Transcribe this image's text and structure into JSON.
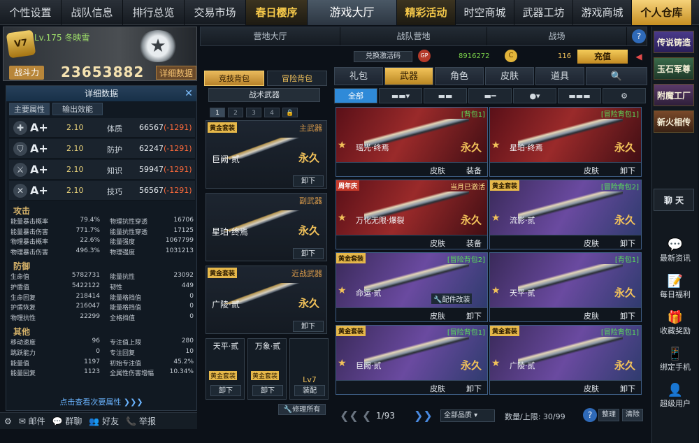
{
  "topnav": {
    "tabs": [
      "个性设置",
      "战队信息",
      "排行总览",
      "交易市场",
      "春日樱序",
      "游戏大厅",
      "精彩活动",
      "时空商城",
      "武器工坊",
      "游戏商城",
      "个人仓库"
    ]
  },
  "profile": {
    "level_name": "Lv.175 冬映雪",
    "level_badge": "V7",
    "cp_label": "战斗力",
    "cp_value": "23653882",
    "detail_btn": "详细数据"
  },
  "attr": {
    "title": "详细数据",
    "close": "✕",
    "subtabs": [
      "主要属性",
      "输出效能"
    ],
    "rows": [
      {
        "icon": "✚",
        "grade": "A+",
        "mul": "2.10",
        "name": "体质",
        "val": "66567",
        "diff": "(-1291)"
      },
      {
        "icon": "⛉",
        "grade": "A+",
        "mul": "2.10",
        "name": "防护",
        "val": "62247",
        "diff": "(-1291)"
      },
      {
        "icon": "⚔",
        "grade": "A+",
        "mul": "2.10",
        "name": "知识",
        "val": "59947",
        "diff": "(-1291)"
      },
      {
        "icon": "✕",
        "grade": "A+",
        "mul": "2.10",
        "name": "技巧",
        "val": "56567",
        "diff": "(-1291)"
      }
    ],
    "sections": [
      {
        "title": "攻击",
        "stats": [
          [
            "能量暴击概率",
            "79.4%",
            "物理抗性穿透",
            "16706"
          ],
          [
            "能量暴击伤害",
            "771.7%",
            "能量抗性穿透",
            "17125"
          ],
          [
            "物理暴击概率",
            "22.6%",
            "能量强度",
            "1067799"
          ],
          [
            "物理暴击伤害",
            "496.3%",
            "物理强度",
            "1031213"
          ]
        ]
      },
      {
        "title": "防御",
        "stats": [
          [
            "生命值",
            "5782731",
            "能量抗性",
            "23092"
          ],
          [
            "护盾值",
            "5422122",
            "韧性",
            "449"
          ],
          [
            "生命回复",
            "218414",
            "能量格挡值",
            "0"
          ],
          [
            "护盾恢复",
            "216047",
            "能量格挡值",
            "0"
          ],
          [
            "物理抗性",
            "22299",
            "全格挡值",
            "0"
          ]
        ]
      },
      {
        "title": "其他",
        "stats": [
          [
            "移动速度",
            "96",
            "专注值上限",
            "280"
          ],
          [
            "跳跃能力",
            "0",
            "专注回复",
            "10"
          ],
          [
            "能量值",
            "1197",
            "初始专注值",
            "45.2%"
          ],
          [
            "能量回复",
            "1123",
            "全属性伤害增幅",
            "10.34%"
          ]
        ]
      }
    ],
    "more": "点击查看次要属性 ❯❯❯"
  },
  "bottombar": [
    "⚙",
    "✉ 邮件",
    "💬 群聊",
    "👥 好友",
    "📞 举报"
  ],
  "subnav": [
    "营地大厅",
    "战队营地",
    "战场"
  ],
  "help": "?",
  "bag": {
    "tabs": [
      "竞技背包",
      "冒险背包"
    ],
    "tactical": "战术武器",
    "pages": [
      "1",
      "2",
      "3",
      "4",
      "🔒"
    ],
    "slots": [
      {
        "badge": "黄金套装",
        "type": "主武器",
        "name": "巨阙·贰",
        "perm": "永久",
        "btn": "卸下"
      },
      {
        "badge": "",
        "type": "副武器",
        "name": "星珀·终焉",
        "perm": "永久",
        "btn": "卸下"
      },
      {
        "badge": "黄金套装",
        "type": "近战武器",
        "name": "广陵·贰",
        "perm": "永久",
        "btn": "卸下"
      }
    ],
    "minis": [
      {
        "name": "天平·贰",
        "badge": "黄金套装",
        "btn": "卸下"
      },
      {
        "name": "万象·贰",
        "badge": "黄金套装",
        "btn": "卸下"
      },
      {
        "name": "Lv7",
        "badge": "",
        "btn": "装配"
      }
    ],
    "fixall": "🔧修理所有"
  },
  "currency": {
    "redeem": "兑换激活码",
    "gp": "GP",
    "gp_val": "8916272",
    "coin": "C",
    "coin_val": "116",
    "recharge": "充值",
    "vol": "◀"
  },
  "cattabs": [
    "礼包",
    "武器",
    "角色",
    "皮肤",
    "道具",
    "🔍"
  ],
  "subfilters": [
    "全部",
    "▬▬▾",
    "▬▬",
    "▬━",
    "●▾",
    "▬▬▬",
    "⚙"
  ],
  "cards": [
    {
      "style": "red",
      "top": "",
      "toptype": "",
      "tag": "[背包1]",
      "tagcolor": "g",
      "name": "瑶光·终焉",
      "perm": "永久",
      "b1": "皮肤",
      "b2": "装备",
      "mod": ""
    },
    {
      "style": "red",
      "top": "",
      "toptype": "",
      "tag": "[冒险背包1]",
      "tagcolor": "g",
      "name": "星珀·终焉",
      "perm": "永久",
      "b1": "皮肤",
      "b2": "卸下",
      "mod": ""
    },
    {
      "style": "red",
      "top": "周年庆",
      "toptype": "red",
      "tag": "当月已激活",
      "tagcolor": "y",
      "name": "万化无限·爆裂",
      "perm": "永久",
      "b1": "皮肤",
      "b2": "装备",
      "mod": ""
    },
    {
      "style": "purp",
      "top": "黄金套装",
      "toptype": "gold",
      "tag": "[冒险背包2]",
      "tagcolor": "g",
      "name": "流影·贰",
      "perm": "永久",
      "b1": "皮肤",
      "b2": "卸下",
      "mod": ""
    },
    {
      "style": "purp",
      "top": "黄金套装",
      "toptype": "gold",
      "tag": "[冒险背包2]",
      "tagcolor": "g",
      "name": "命运·贰",
      "perm": "",
      "b1": "皮肤",
      "b2": "卸下",
      "mod": "🔧配件改装"
    },
    {
      "style": "purp",
      "top": "",
      "toptype": "",
      "tag": "[背包1]",
      "tagcolor": "g",
      "name": "天平·贰",
      "perm": "永久",
      "b1": "皮肤",
      "b2": "卸下",
      "mod": ""
    },
    {
      "style": "purp",
      "top": "黄金套装",
      "toptype": "gold",
      "tag": "[冒险背包1]",
      "tagcolor": "g",
      "name": "巨阙·贰",
      "perm": "永久",
      "b1": "皮肤",
      "b2": "卸下",
      "mod": ""
    },
    {
      "style": "purp",
      "top": "黄金套装",
      "toptype": "gold",
      "tag": "[冒险背包1]",
      "tagcolor": "g",
      "name": "广陵·贰",
      "perm": "永久",
      "b1": "皮肤",
      "b2": "卸下",
      "mod": ""
    }
  ],
  "pager": {
    "page": "1/93",
    "quality": "全部品质 ▾",
    "capacity": "数量/上限: 30/99",
    "sort": "整理",
    "clear": "清除",
    "help": "?"
  },
  "sidebar": {
    "buttons": [
      "传说铸造",
      "玉石军尊",
      "附魔工厂",
      "新火相传"
    ],
    "chat": "聊 天",
    "icons": [
      {
        "g": "💬",
        "t": "最新资讯"
      },
      {
        "g": "📝",
        "t": "每日福利"
      },
      {
        "g": "🎁",
        "t": "收藏奖励"
      },
      {
        "g": "📱",
        "t": "绑定手机"
      },
      {
        "g": "👤",
        "t": "超级用户"
      }
    ]
  }
}
